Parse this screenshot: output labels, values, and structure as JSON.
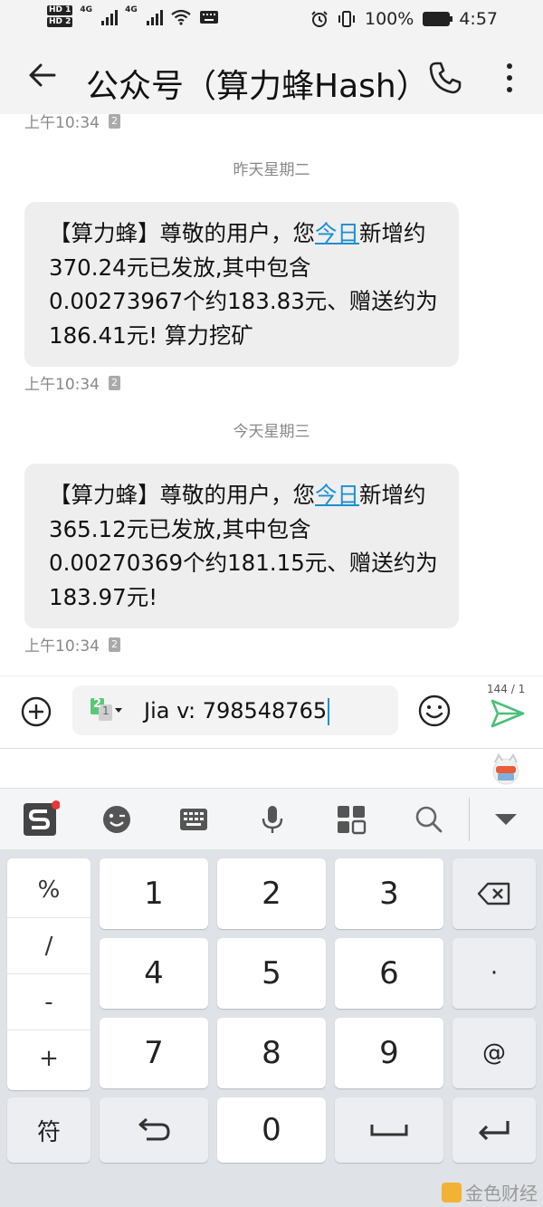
{
  "status_bar": {
    "hd1": "HD 1",
    "hd2": "HD 2",
    "network1": "4G",
    "network2": "4G",
    "battery": "100%",
    "time": "4:57"
  },
  "header": {
    "title": "公众号（算力蜂Hash）"
  },
  "messages": [
    {
      "timestamp": "上午10:34",
      "sim": "2"
    },
    {
      "day": "昨天星期二",
      "text_before_link": "【算力蜂】尊敬的用户，您",
      "link": "今日",
      "text_after_link": "新增约370.24元已发放,其中包含0.00273967个约183.83元、赠送约为186.41元! 算力挖矿",
      "timestamp": "上午10:34",
      "sim": "2"
    },
    {
      "day": "今天星期三",
      "text_before_link": "【算力蜂】尊敬的用户，您",
      "link": "今日",
      "text_after_link": "新增约365.12元已发放,其中包含0.00270369个约181.15元、赠送约为183.97元!",
      "timestamp": "上午10:34",
      "sim": "2"
    }
  ],
  "composer": {
    "sim_digit_main": "2",
    "sim_digit_sub": "1",
    "value": "Jia v: 798548765",
    "char_counter": "144 / 1"
  },
  "keyboard": {
    "symbols": [
      "%",
      "/",
      "-",
      "+"
    ],
    "digits": [
      "1",
      "2",
      "3",
      "4",
      "5",
      "6",
      "7",
      "8",
      "9",
      "0"
    ],
    "dot": "·",
    "at": "@",
    "fu": "符"
  },
  "watermark": "金色财经"
}
